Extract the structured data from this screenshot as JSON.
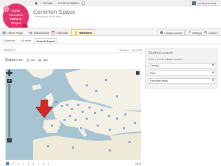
{
  "topbar": {
    "breadcrumbs": [
      "Groups",
      "Common Space"
    ],
    "user_email": "[email protected]"
  },
  "logo": {
    "lines": [
      "Higher",
      "Education",
      "Reform",
      "Project"
    ]
  },
  "group": {
    "title": "Common Space",
    "subtitle": "A small group for all users"
  },
  "tabs": [
    {
      "label": "Home Page"
    },
    {
      "label": "Discussions"
    },
    {
      "label": "Calendar"
    },
    {
      "label": "Members"
    }
  ],
  "actions": {
    "create": "Create content",
    "settings": "Settings",
    "search": "Search"
  },
  "subtabs": [
    "Directory",
    "All users",
    "Search Expert"
  ],
  "results": {
    "label": "RESULTS",
    "count": "Results 1 - 10 of 370"
  },
  "display": {
    "label": "Display as:",
    "list": "List",
    "map": "Map"
  },
  "map": {
    "zoom_in": "+",
    "zoom_out": "−"
  },
  "pager": {
    "pages": [
      "1",
      "2",
      "3",
      "4",
      "5",
      "6",
      "7",
      "8",
      "9"
    ],
    "current": "1",
    "next": "Next"
  },
  "guided_search": {
    "title": "Guided search",
    "hint": "Click a term to initiate a search.",
    "facets": [
      {
        "label": "Country",
        "toggle": "+"
      },
      {
        "label": "Role",
        "toggle": "+"
      },
      {
        "label": "Expertise fields",
        "toggle": "+"
      }
    ]
  },
  "colors": {
    "accent": "#e2336b",
    "active_tab": "#fdf6d8",
    "marker": "#d62828",
    "sea": "#a6c4d2",
    "land": "#f3f0e6"
  }
}
